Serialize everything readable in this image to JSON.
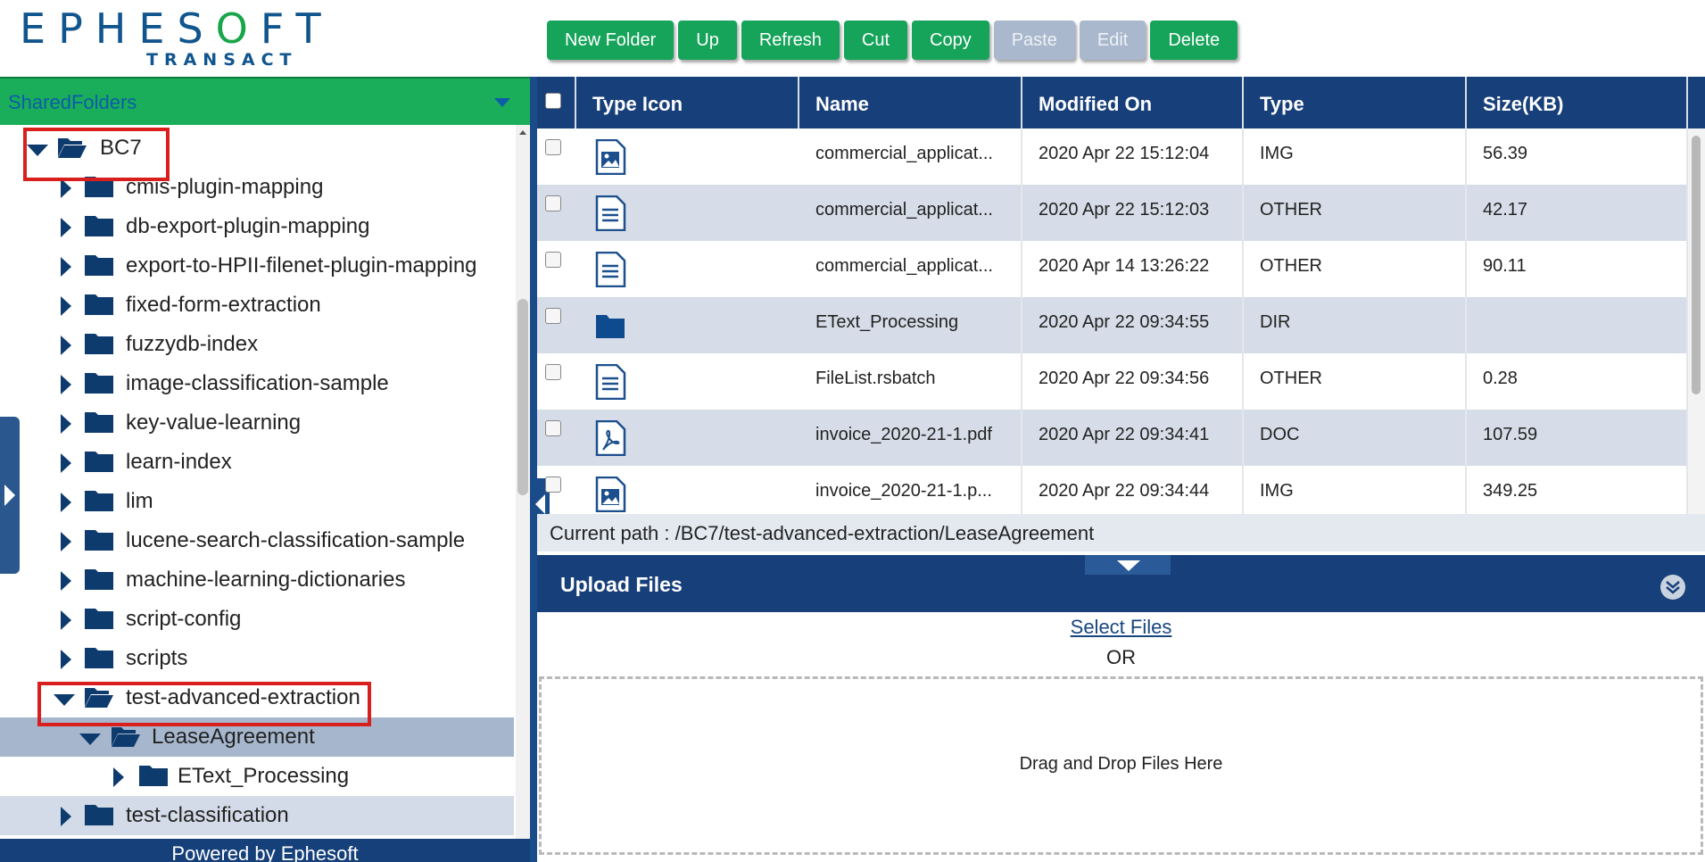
{
  "header": {
    "logo_text": "EPHESOFT",
    "logo_sub": "TRANSACT"
  },
  "toolbar": {
    "buttons": [
      {
        "label": "New Folder",
        "enabled": true
      },
      {
        "label": "Up",
        "enabled": true
      },
      {
        "label": "Refresh",
        "enabled": true
      },
      {
        "label": "Cut",
        "enabled": true
      },
      {
        "label": "Copy",
        "enabled": true
      },
      {
        "label": "Paste",
        "enabled": false
      },
      {
        "label": "Edit",
        "enabled": false
      },
      {
        "label": "Delete",
        "enabled": true
      }
    ]
  },
  "sidebar": {
    "dropdown_label": "SharedFolders",
    "tree": [
      {
        "label": "BC7",
        "depth": 0,
        "expanded": true
      },
      {
        "label": "cmis-plugin-mapping",
        "depth": 1,
        "expanded": false
      },
      {
        "label": "db-export-plugin-mapping",
        "depth": 1,
        "expanded": false
      },
      {
        "label": "export-to-HPII-filenet-plugin-mapping",
        "depth": 1,
        "expanded": false
      },
      {
        "label": "fixed-form-extraction",
        "depth": 1,
        "expanded": false
      },
      {
        "label": "fuzzydb-index",
        "depth": 1,
        "expanded": false
      },
      {
        "label": "image-classification-sample",
        "depth": 1,
        "expanded": false
      },
      {
        "label": "key-value-learning",
        "depth": 1,
        "expanded": false
      },
      {
        "label": "learn-index",
        "depth": 1,
        "expanded": false
      },
      {
        "label": "lim",
        "depth": 1,
        "expanded": false
      },
      {
        "label": "lucene-search-classification-sample",
        "depth": 1,
        "expanded": false
      },
      {
        "label": "machine-learning-dictionaries",
        "depth": 1,
        "expanded": false
      },
      {
        "label": "script-config",
        "depth": 1,
        "expanded": false
      },
      {
        "label": "scripts",
        "depth": 1,
        "expanded": false
      },
      {
        "label": "test-advanced-extraction",
        "depth": 1,
        "expanded": true
      },
      {
        "label": "LeaseAgreement",
        "depth": 2,
        "expanded": true,
        "selected": true
      },
      {
        "label": "EText_Processing",
        "depth": 3,
        "expanded": false
      },
      {
        "label": "test-classification",
        "depth": 1,
        "expanded": false,
        "hover": true
      }
    ],
    "footer": "Powered by Ephesoft"
  },
  "grid": {
    "columns": [
      "Type Icon",
      "Name",
      "Modified On",
      "Type",
      "Size(KB)"
    ],
    "rows": [
      {
        "icon": "image-file-icon",
        "name": "commercial_applicat...",
        "modified": "2020 Apr 22 15:12:04",
        "type": "IMG",
        "size": "56.39"
      },
      {
        "icon": "document-file-icon",
        "name": "commercial_applicat...",
        "modified": "2020 Apr 22 15:12:03",
        "type": "OTHER",
        "size": "42.17"
      },
      {
        "icon": "document-file-icon",
        "name": "commercial_applicat...",
        "modified": "2020 Apr 14 13:26:22",
        "type": "OTHER",
        "size": "90.11"
      },
      {
        "icon": "folder-icon",
        "name": "EText_Processing",
        "modified": "2020 Apr 22 09:34:55",
        "type": "DIR",
        "size": ""
      },
      {
        "icon": "document-file-icon",
        "name": "FileList.rsbatch",
        "modified": "2020 Apr 22 09:34:56",
        "type": "OTHER",
        "size": "0.28"
      },
      {
        "icon": "pdf-file-icon",
        "name": "invoice_2020-21-1.pdf",
        "modified": "2020 Apr 22 09:34:41",
        "type": "DOC",
        "size": "107.59"
      },
      {
        "icon": "image-file-icon",
        "name": "invoice_2020-21-1.p...",
        "modified": "2020 Apr 22 09:34:44",
        "type": "IMG",
        "size": "349.25"
      }
    ],
    "current_path_label": "Current path : /BC7/test-advanced-extraction/LeaseAgreement"
  },
  "upload": {
    "title": "Upload Files",
    "select_files": "Select Files",
    "or": "OR",
    "drop_text": "Drag and Drop Files Here"
  },
  "colors": {
    "accent_green": "#1aae5b",
    "header_blue": "#173f7a",
    "disabled": "#a9b8cc",
    "highlight": "#d91e1e"
  }
}
